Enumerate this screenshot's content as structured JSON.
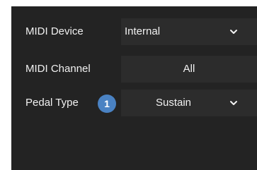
{
  "settings": {
    "rows": [
      {
        "label": "MIDI Device",
        "value": "Internal",
        "control": "dropdown"
      },
      {
        "label": "MIDI Channel",
        "value": "All",
        "control": "button"
      },
      {
        "label": "Pedal Type",
        "value": "Sustain",
        "control": "dropdown",
        "badge": "1"
      }
    ]
  },
  "icons": {
    "dropdown": "chevron-down-icon"
  },
  "colors": {
    "panel_bg": "#232323",
    "control_bg": "#2c2c2c",
    "badge_bg": "#4a82c3",
    "text": "#f1f1f1"
  }
}
